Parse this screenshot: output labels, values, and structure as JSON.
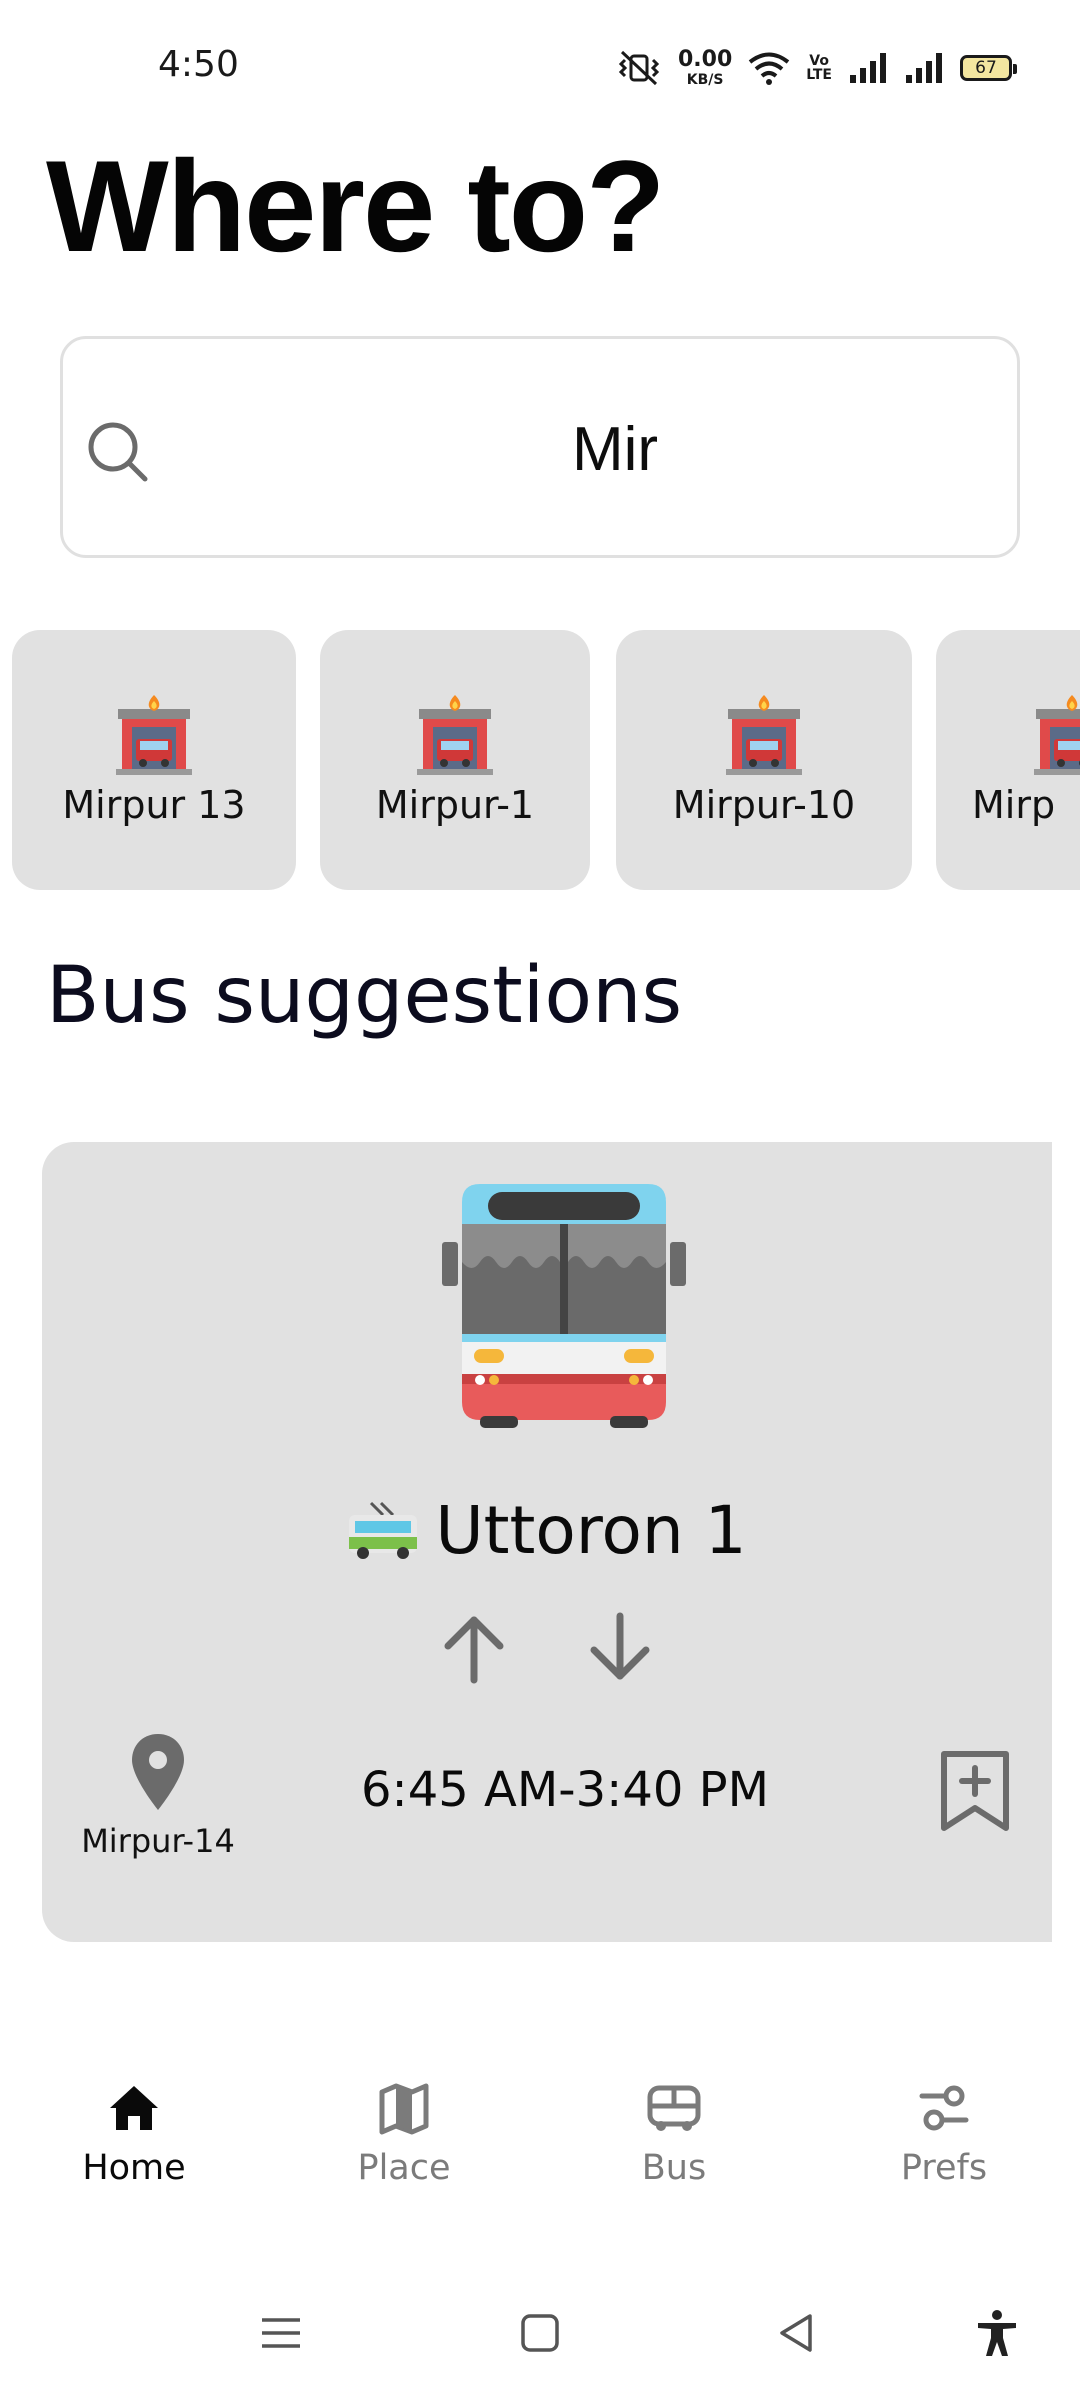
{
  "status_bar": {
    "time": "4:50",
    "net_speed_value": "0.00",
    "net_speed_unit": "KB/S",
    "volte_line1": "Vo",
    "volte_line2": "LTE",
    "battery_level": "67"
  },
  "page": {
    "title": "Where to?"
  },
  "search": {
    "value": "Mir",
    "icon": "search-icon"
  },
  "place_chips": [
    {
      "label": "Mirpur 13",
      "icon": "fire-station-icon"
    },
    {
      "label": "Mirpur-1",
      "icon": "fire-station-icon"
    },
    {
      "label": "Mirpur-10",
      "icon": "fire-station-icon"
    },
    {
      "label": "Mirp",
      "icon": "fire-station-icon"
    }
  ],
  "bus_section": {
    "title": "Bus suggestions",
    "card": {
      "illustration": "bus-front-icon",
      "route_icon": "trolleybus-icon",
      "route_name": "Uttoron 1",
      "direction_up_icon": "arrow-up-icon",
      "direction_down_icon": "arrow-down-icon",
      "stop_icon": "map-pin-icon",
      "stop_name": "Mirpur-14",
      "time_range": "6:45 AM-3:40 PM",
      "bookmark_icon": "bookmark-add-icon"
    }
  },
  "bottom_nav": {
    "items": [
      {
        "label": "Home",
        "icon": "home-icon",
        "active": true
      },
      {
        "label": "Place",
        "icon": "map-icon",
        "active": false
      },
      {
        "label": "Bus",
        "icon": "bus-icon",
        "active": false
      },
      {
        "label": "Prefs",
        "icon": "sliders-icon",
        "active": false
      }
    ]
  },
  "system_nav": {
    "buttons": [
      "menu-icon",
      "home-square-icon",
      "back-icon",
      "accessibility-icon"
    ]
  },
  "colors": {
    "card_background": "#e1e1e1",
    "nav_inactive": "#7b7b7b",
    "nav_active": "#0a0a0a",
    "icon_gray": "#6b6b6b"
  }
}
